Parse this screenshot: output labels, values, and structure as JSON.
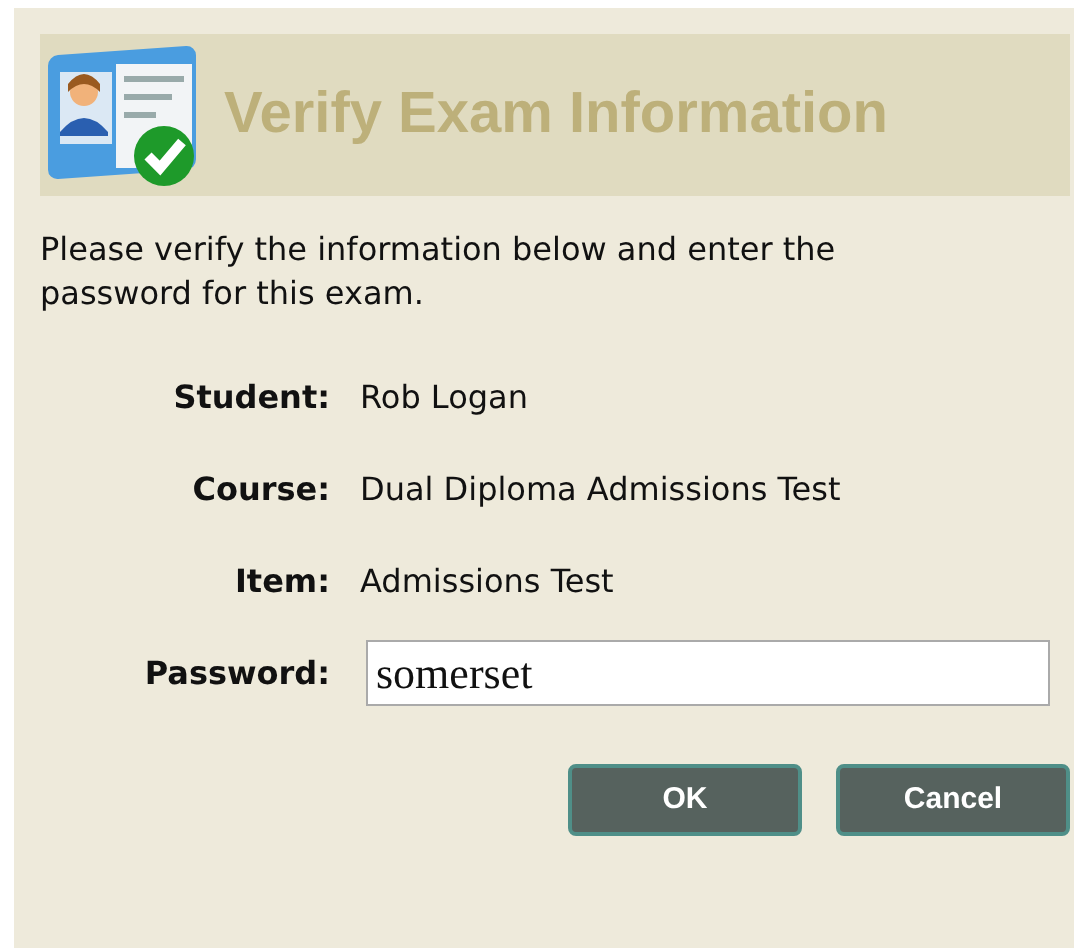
{
  "dialog": {
    "title": "Verify Exam Information",
    "instructions": "Please verify the information below and enter the password for this exam.",
    "fields": [
      {
        "label": "Student:",
        "value": "Rob Logan"
      },
      {
        "label": "Course:",
        "value": "Dual Diploma Admissions Test"
      },
      {
        "label": "Item:",
        "value": "Admissions Test"
      }
    ],
    "password": {
      "label": "Password:",
      "value": "somerset"
    },
    "buttons": [
      "OK",
      "Cancel"
    ]
  }
}
